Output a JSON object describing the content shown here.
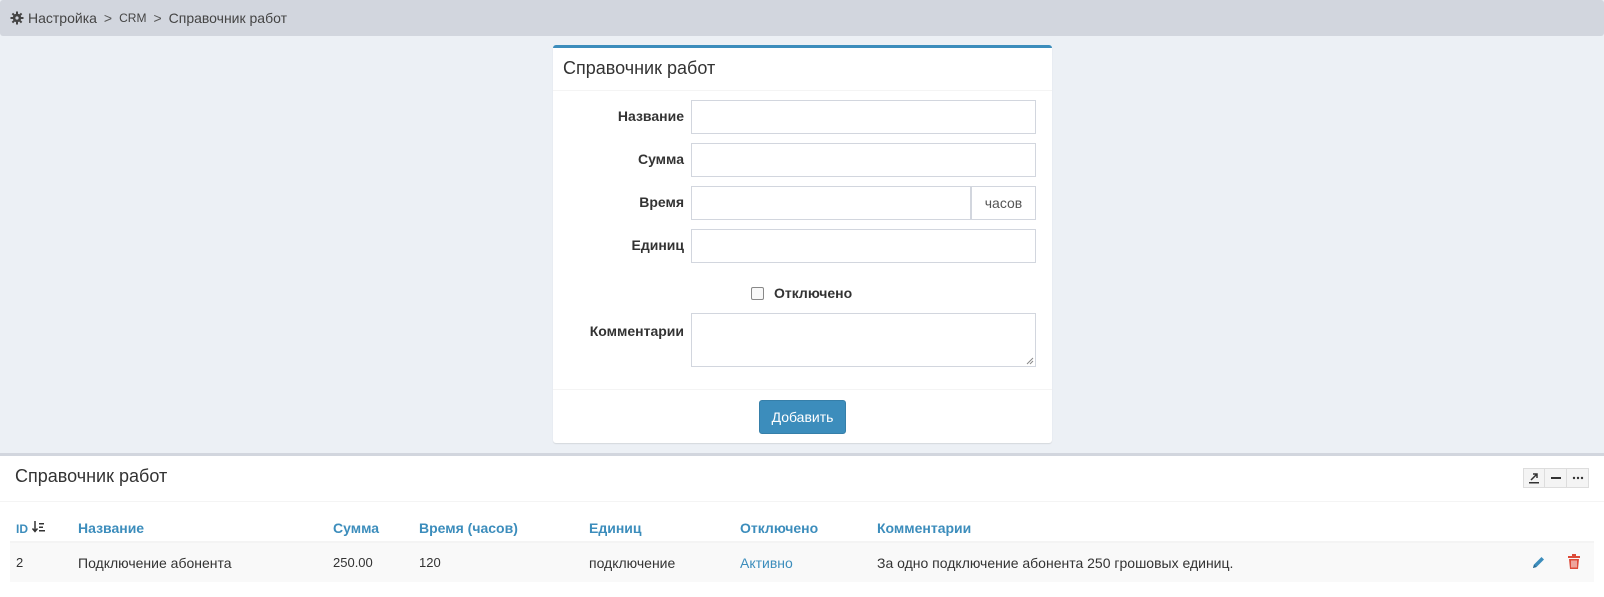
{
  "breadcrumb": {
    "icon": "gear-icon",
    "items": [
      "Настройка",
      "CRM",
      "Справочник работ"
    ],
    "separator": ">"
  },
  "form": {
    "title": "Справочник работ",
    "fields": {
      "name": {
        "label": "Название",
        "value": ""
      },
      "sum": {
        "label": "Сумма",
        "value": ""
      },
      "time": {
        "label": "Время",
        "value": "",
        "addon": "часов"
      },
      "units": {
        "label": "Единиц",
        "value": ""
      },
      "disabled": {
        "label": "Отключено",
        "checked": false
      },
      "comment": {
        "label": "Комментарии",
        "value": ""
      }
    },
    "submit_label": "Добавить"
  },
  "list": {
    "title": "Справочник работ",
    "tools": [
      "export-icon",
      "minus-icon",
      "more-icon"
    ],
    "columns": [
      "ID",
      "Название",
      "Сумма",
      "Время (часов)",
      "Единиц",
      "Отключено",
      "Комментарии"
    ],
    "rows": [
      {
        "id": "2",
        "name": "Подключение абонента",
        "sum": "250.00",
        "time": "120",
        "units": "подключение",
        "status": "Активно",
        "comment": "За одно подключение абонента 250 грошовых единиц."
      }
    ]
  },
  "colors": {
    "accent": "#3c8dbc",
    "background": "#ecf0f5",
    "delete": "#dd4b39"
  }
}
